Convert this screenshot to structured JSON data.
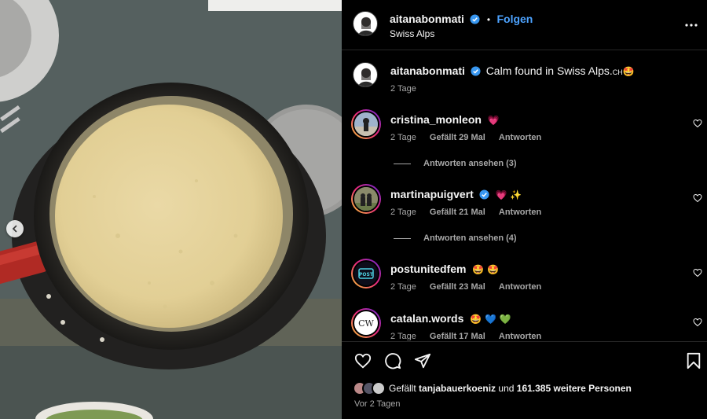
{
  "post": {
    "author": "aitanabonmati",
    "follow_label": "Folgen",
    "separator": "•",
    "location": "Swiss Alps",
    "caption": "Calm found in Swiss Alps.",
    "caption_suffix": "CH",
    "caption_emoji": "🤩",
    "caption_time": "2 Tage"
  },
  "comments": [
    {
      "user": "cristina_monleon",
      "verified": false,
      "emoji": "💗",
      "time": "2 Tage",
      "likes": "Gefällt 29 Mal",
      "reply": "Antworten",
      "view_replies": "Antworten ansehen (3)"
    },
    {
      "user": "martinapuigvert",
      "verified": true,
      "emoji": "💗 ✨",
      "time": "2 Tage",
      "likes": "Gefällt 21 Mal",
      "reply": "Antworten",
      "view_replies": "Antworten ansehen (4)"
    },
    {
      "user": "postunitedfem",
      "verified": false,
      "emoji": "🤩 🤩",
      "time": "2 Tage",
      "likes": "Gefällt 23 Mal",
      "reply": "Antworten"
    },
    {
      "user": "catalan.words",
      "verified": false,
      "emoji": "🤩 💙 💚",
      "time": "2 Tage",
      "likes": "Gefällt 17 Mal",
      "reply": "Antworten",
      "avatar_text": "CW"
    },
    {
      "avatar_badge_text": "POST"
    }
  ],
  "footer": {
    "likes_prefix": "Gefällt",
    "liked_by": "tanjabauerkoeniz",
    "likes_middle": "und",
    "likes_count": "161.385 weitere Personen",
    "time_ago": "Vor 2 Tagen"
  },
  "icons": {
    "heart": "heart-icon",
    "comment": "comment-icon",
    "share": "share-icon",
    "save": "bookmark-icon",
    "more": "more-icon",
    "verified": "verified-badge-icon",
    "prev": "chevron-left-icon"
  },
  "colors": {
    "accent": "#4da3ff",
    "verified": "#3897f0",
    "muted": "#a8a8a8",
    "panel_bg": "#000000"
  }
}
